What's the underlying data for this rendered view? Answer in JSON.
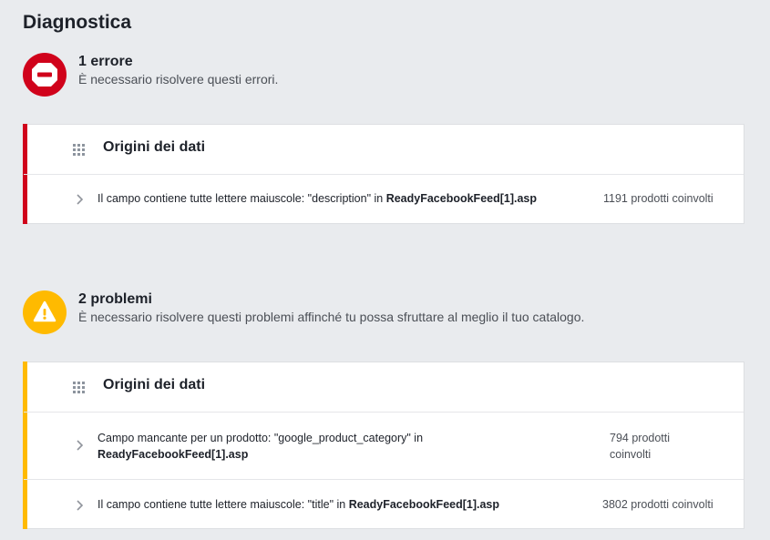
{
  "page": {
    "title": "Diagnostica"
  },
  "colors": {
    "error": "#d0021b",
    "warning": "#ffba00",
    "background": "#e9ebee"
  },
  "errors": {
    "icon": "no-entry-icon",
    "title": "1 errore",
    "description": "È necessario risolvere questi errori.",
    "card": {
      "title": "Origini dei dati",
      "icon": "grid-icon",
      "rows": [
        {
          "text_prefix": "Il campo contiene tutte lettere maiuscole: \"description\" in ",
          "file": "ReadyFacebookFeed[1].asp",
          "count": "1191 prodotti coinvolti"
        }
      ]
    }
  },
  "warnings": {
    "icon": "warning-icon",
    "title": "2 problemi",
    "description": "È necessario risolvere questi problemi affinché tu possa sfruttare al meglio il tuo catalogo.",
    "card": {
      "title": "Origini dei dati",
      "icon": "grid-icon",
      "rows": [
        {
          "text_prefix": "Campo mancante per un prodotto: \"google_product_category\" in",
          "file": "ReadyFacebookFeed[1].asp",
          "count": "794 prodotti coinvolti"
        },
        {
          "text_prefix": "Il campo contiene tutte lettere maiuscole: \"title\" in ",
          "file": "ReadyFacebookFeed[1].asp",
          "count": "3802 prodotti coinvolti"
        }
      ]
    }
  }
}
